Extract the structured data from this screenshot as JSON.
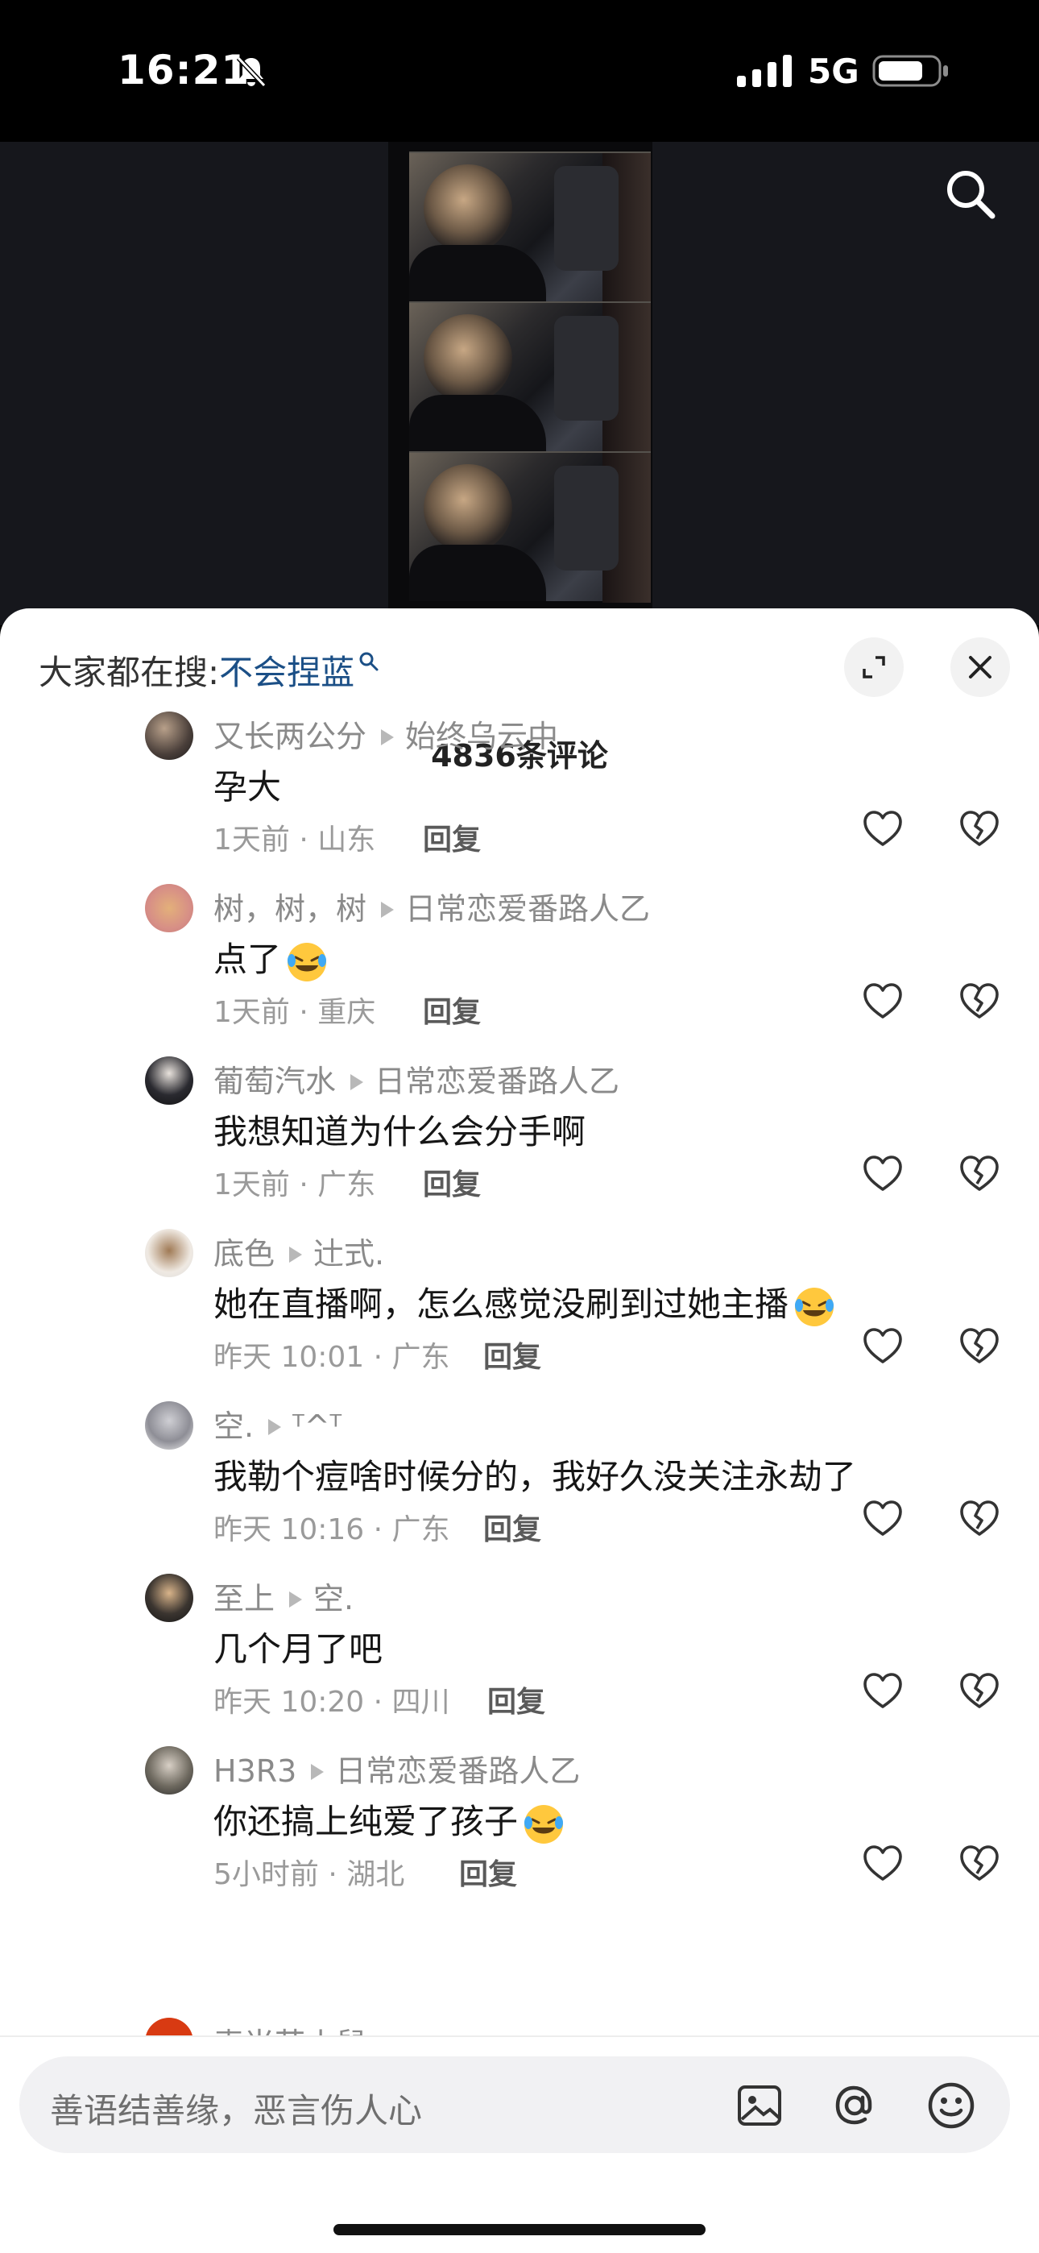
{
  "status_bar": {
    "time": "16:21",
    "network": "5G"
  },
  "sheet": {
    "search_prefix": "大家都在搜:",
    "search_keyword": "不会捏蓝",
    "comment_count": "4836条评论"
  },
  "comments": [
    {
      "author": "又长两公分",
      "reply_to": "始终乌云中",
      "text": "孕大",
      "time": "1天前",
      "location": "山东",
      "reply": "回复",
      "emoji": false
    },
    {
      "author": "树，树，树",
      "reply_to": "日常恋爱番路人乙",
      "text": "点了",
      "time": "1天前",
      "location": "重庆",
      "reply": "回复",
      "emoji": true
    },
    {
      "author": "葡萄汽水",
      "reply_to": "日常恋爱番路人乙",
      "text": "我想知道为什么会分手啊",
      "time": "1天前",
      "location": "广东",
      "reply": "回复",
      "emoji": false
    },
    {
      "author": "底色",
      "reply_to": "辻式.",
      "text": "她在直播啊，怎么感觉没刷到过她主播",
      "time": "昨天 10:01",
      "location": "广东",
      "reply": "回复",
      "emoji": true
    },
    {
      "author": "空.",
      "reply_to": "ᵀ^ᵀ",
      "text": "我勒个痘啥时候分的，我好久没关注永劫了",
      "time": "昨天 10:16",
      "location": "广东",
      "reply": "回复",
      "emoji": false
    },
    {
      "author": "至上",
      "reply_to": "空.",
      "text": "几个月了吧",
      "time": "昨天 10:20",
      "location": "四川",
      "reply": "回复",
      "emoji": false
    },
    {
      "author": "H3R3",
      "reply_to": "日常恋爱番路人乙",
      "text": "你还搞上纯爱了孩子",
      "time": "5小时前",
      "location": "湖北",
      "reply": "回复",
      "emoji": true
    }
  ],
  "peek": {
    "author": "麦当劳小鼠"
  },
  "composer": {
    "placeholder": "善语结善缘，恶言伤人心"
  },
  "colors": {
    "keyword": "#1b4f86",
    "meta": "#9a9a9a",
    "sheet_bg": "#ffffff",
    "video_bg": "#16171c"
  }
}
